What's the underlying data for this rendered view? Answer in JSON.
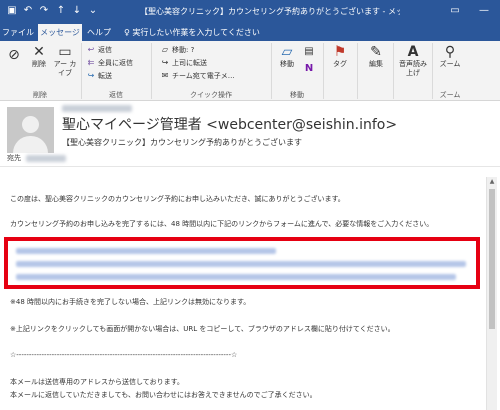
{
  "titlebar": {
    "save_icon": "save-icon",
    "undo_icon": "undo-icon",
    "redo_icon": "redo-icon",
    "up_icon": "arrow-up-icon",
    "down_icon": "arrow-down-icon",
    "dropdown_icon": "chevron-down-icon",
    "title": "【聖心美容クリニック】カウンセリング予約ありがとうございます - メッセージ (テキスト",
    "ribbon_display_icon": "ribbon-display-icon",
    "minimize_icon": "minimize-icon",
    "quick_access_glyphs": {
      "save": "▣",
      "undo": "↶",
      "redo": "↷",
      "up": "↑",
      "down": "↓",
      "more": "⌄"
    },
    "window_glyphs": {
      "ribbon": "▭",
      "minimize": "—"
    }
  },
  "tabs": [
    {
      "label": "ファイル",
      "active": false
    },
    {
      "label": "メッセージ",
      "active": true
    },
    {
      "label": "ヘルプ",
      "active": false
    }
  ],
  "tellme": {
    "label": "実行したい作業を入力してください",
    "icon": "lightbulb-icon",
    "glyph": "♀"
  },
  "ribbon": {
    "groups": [
      {
        "label": "削除"
      },
      {
        "label": "返信"
      },
      {
        "label": "クイック操作"
      },
      {
        "label": "移動"
      },
      {
        "label": ""
      },
      {
        "label": ""
      },
      {
        "label": "ズーム"
      }
    ],
    "junk": {
      "icon": "junk-mail-icon",
      "glyph": "⊘"
    },
    "delete": {
      "label": "削除",
      "icon": "delete-x-icon",
      "glyph": "✕"
    },
    "archive": {
      "label": "アー カイブ",
      "icon": "archive-box-icon",
      "glyph": "▭"
    },
    "reply": {
      "label": "返信",
      "icon": "reply-icon",
      "glyph": "↩"
    },
    "reply_all": {
      "label": "全員に返信",
      "icon": "reply-all-icon",
      "glyph": "⇇"
    },
    "forward": {
      "label": "転送",
      "icon": "forward-icon",
      "glyph": "↪"
    },
    "quick_steps": [
      {
        "label": "移動: ?",
        "icon": "folder-icon",
        "glyph": "▱"
      },
      {
        "label": "上司に転送",
        "icon": "forward-to-manager-icon",
        "glyph": "↪"
      },
      {
        "label": "チーム宛て電子メ…",
        "icon": "team-email-icon",
        "glyph": "✉"
      }
    ],
    "move": {
      "label": "移動",
      "icon": "move-folder-icon",
      "glyph": "▱"
    },
    "rules": {
      "icon": "rules-icon",
      "glyph": "▤"
    },
    "onenote": {
      "icon": "onenote-icon",
      "glyph": "N"
    },
    "tags": {
      "label": "タグ",
      "icon": "flag-icon",
      "glyph": "⚑"
    },
    "editing": {
      "label": "編集",
      "icon": "edit-icon",
      "glyph": "✎"
    },
    "read_aloud": {
      "label": "音声読み 上げ",
      "icon": "read-aloud-icon",
      "glyph": "A"
    },
    "zoom": {
      "label": "ズーム",
      "icon": "zoom-icon",
      "glyph": "⚲"
    }
  },
  "header": {
    "avatar_icon": "contact-avatar-icon",
    "sender": "聖心マイページ管理者 <webcenter@seishin.info>",
    "subject": "【聖心美容クリニック】カウンセリング予約ありがとうございます",
    "to_label": "宛先"
  },
  "body": {
    "line1": "この度は、聖心美容クリニックのカウンセリング予約にお申し込みいただき、誠にありがとうございます。",
    "line2": "カウンセリング予約のお申し込みを完了するには、48 時間以内に下記のリンクからフォームに進んで、必要な情報をご入力ください。",
    "line3": "※48 時間以内にお手続きを完了しない場合、上記リンクは無効になります。",
    "line4": "※上記リンクをクリックしても画面が開かない場合は、URL をコピーして、ブラウザのアドレス欄に貼り付けてください。",
    "line5": "☆-------------------------------------------------------------------------------------☆",
    "line6": "本メールは送信専用のアドレスから送信しております。",
    "line7": "本メールに返信していただきましても、お問い合わせにはお答えできませんのでご了承ください。"
  },
  "scrollbar": {
    "up_glyph": "▲",
    "down_glyph": "▼"
  },
  "colors": {
    "titlebar": "#2b579a",
    "ribbon": "#f3f3f3",
    "highlight": "#e60012"
  }
}
